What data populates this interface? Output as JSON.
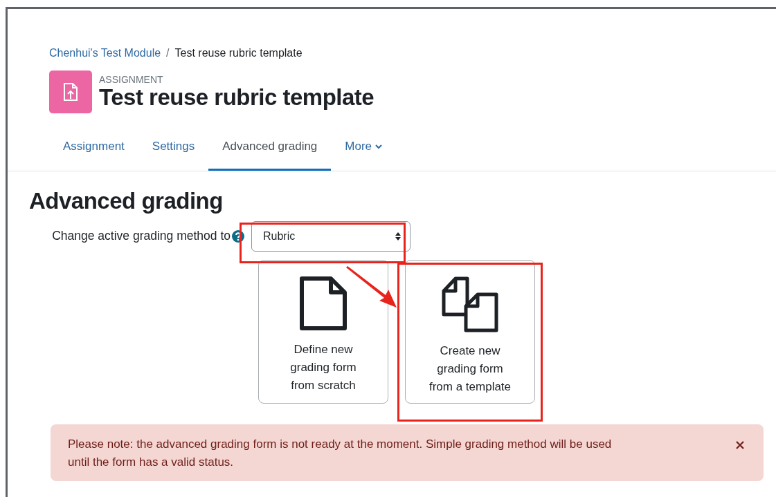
{
  "breadcrumb": [
    {
      "label": "Chenhui's Test Module",
      "link": true
    },
    {
      "label": "/",
      "link": false
    },
    {
      "label": "Test reuse rubric template",
      "link": false
    }
  ],
  "header": {
    "kind_label": "ASSIGNMENT",
    "title": "Test reuse rubric template"
  },
  "tabs": [
    {
      "label": "Assignment",
      "selected": false,
      "has_menu": false
    },
    {
      "label": "Settings",
      "selected": false,
      "has_menu": false
    },
    {
      "label": "Advanced grading",
      "selected": true,
      "has_menu": false
    },
    {
      "label": "More",
      "selected": false,
      "has_menu": true
    }
  ],
  "page_heading": "Advanced grading",
  "method": {
    "label": "Change active grading method to",
    "value": "Rubric"
  },
  "options": [
    {
      "kind": "blank",
      "label": "Define new grading form from scratch"
    },
    {
      "kind": "template",
      "label": "Create new grading form from a template"
    }
  ],
  "alert": {
    "text": "Please note: the advanced grading form is not ready at the moment. Simple grading method will be used until the form has a valid status."
  }
}
